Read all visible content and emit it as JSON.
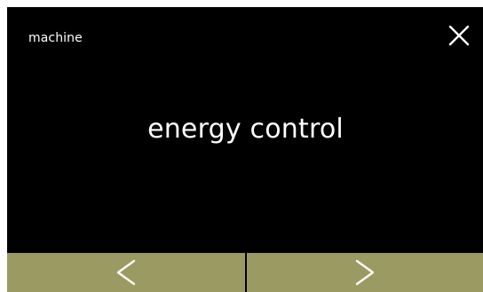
{
  "header": {
    "title": "machine"
  },
  "main": {
    "label": "energy control"
  },
  "icons": {
    "close": "close-icon",
    "previous": "chevron-left-icon",
    "next": "chevron-right-icon"
  },
  "colors": {
    "background": "#000000",
    "text": "#ffffff",
    "nav_button": "#9b9a63"
  }
}
